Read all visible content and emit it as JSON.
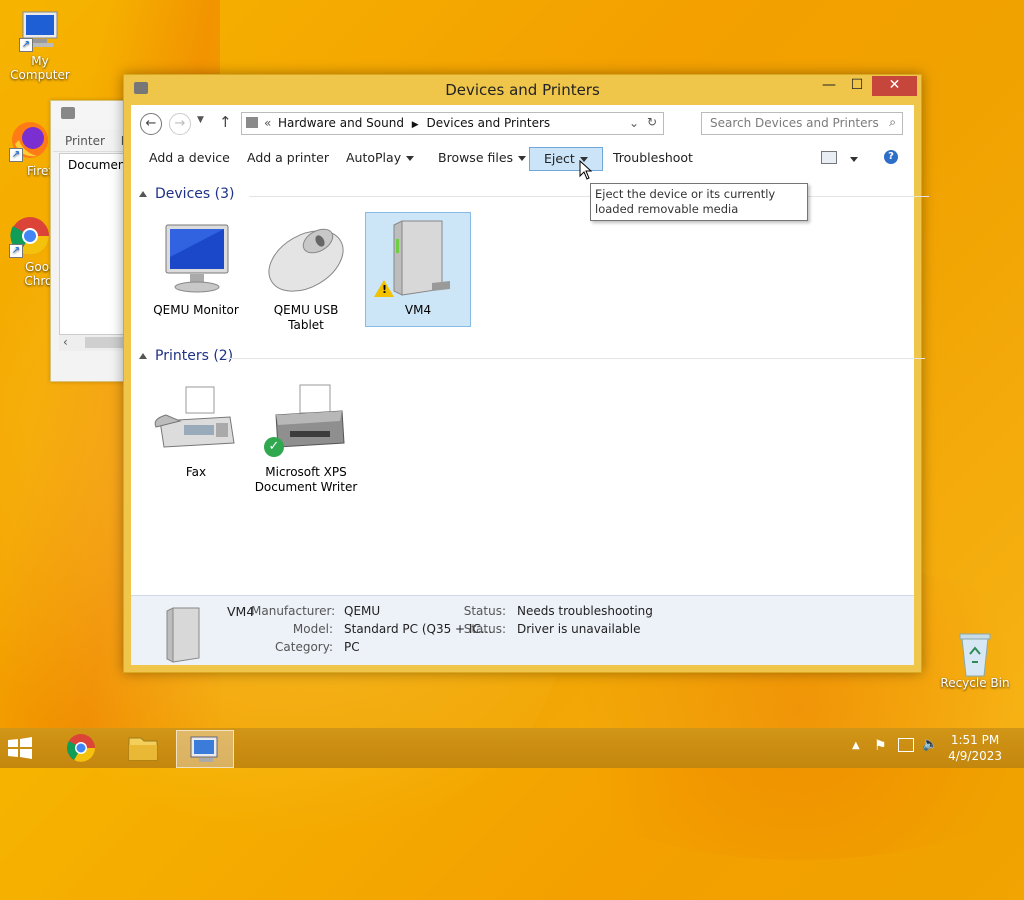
{
  "desktop": {
    "icons": [
      {
        "label": "My Computer"
      },
      {
        "label": "Firefo"
      },
      {
        "label": "Googl Chron"
      },
      {
        "label": "Recycle Bin"
      }
    ]
  },
  "background_window": {
    "header_cols": [
      "Printer",
      "D"
    ],
    "item": "Document"
  },
  "window": {
    "title": "Devices and Printers",
    "controls": {
      "minimize": "—",
      "maximize": "☐",
      "close": "✕"
    }
  },
  "address_bar": {
    "prefix": "«",
    "crumbs": [
      "Hardware and Sound",
      "Devices and Printers"
    ],
    "search_placeholder": "Search Devices and Printers"
  },
  "command_bar": {
    "items": [
      {
        "label": "Add a device"
      },
      {
        "label": "Add a printer"
      },
      {
        "label": "AutoPlay"
      },
      {
        "label": "Browse files"
      },
      {
        "label": "Eject"
      },
      {
        "label": "Troubleshoot"
      }
    ]
  },
  "tooltip": "Eject the device or its currently loaded removable media",
  "groups": {
    "devices": {
      "title": "Devices (3)",
      "items": [
        {
          "label": "QEMU Monitor",
          "icon": "monitor-icon"
        },
        {
          "label": "QEMU USB Tablet",
          "icon": "mouse-icon"
        },
        {
          "label": "VM4",
          "icon": "pc-tower-icon",
          "warning": true
        }
      ]
    },
    "printers": {
      "title": "Printers (2)",
      "items": [
        {
          "label": "Fax",
          "icon": "fax-icon"
        },
        {
          "label": "Microsoft XPS Document Writer",
          "icon": "printer-icon",
          "default": true
        }
      ]
    }
  },
  "details": {
    "name": "VM4",
    "manufacturer_label": "Manufacturer:",
    "manufacturer": "QEMU",
    "model_label": "Model:",
    "model": "Standard PC (Q35 + IC...",
    "category_label": "Category:",
    "category": "PC",
    "status_label": "Status:",
    "status1": "Needs troubleshooting",
    "status2": "Driver is unavailable"
  },
  "taskbar": {
    "time": "1:51 PM",
    "date": "4/9/2023"
  },
  "colors": {
    "accent_window": "#f0c64a",
    "selection": "#cde6f7",
    "group_heading": "#1e3287"
  }
}
